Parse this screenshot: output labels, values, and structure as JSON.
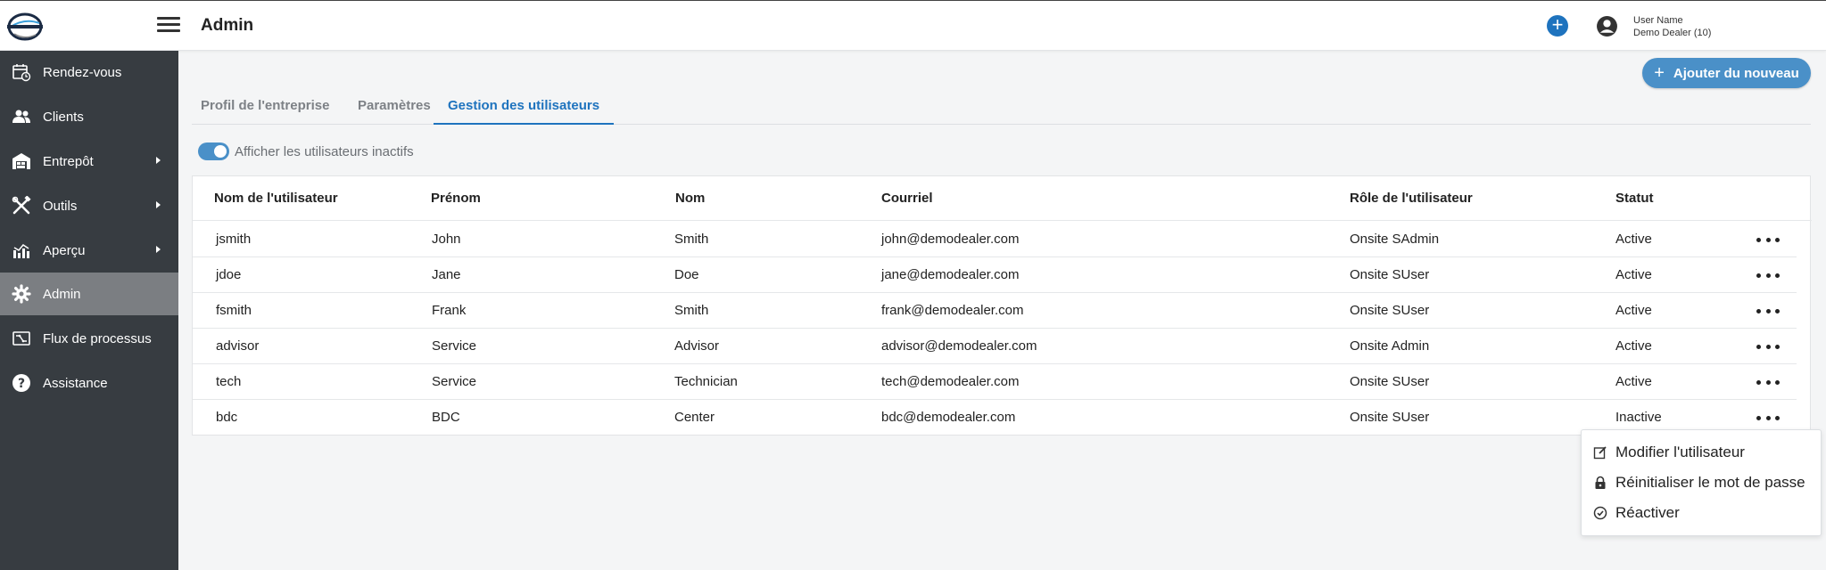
{
  "header": {
    "page_title": "Admin",
    "user_name": "User Name",
    "user_dealer": "Demo Dealer (10)"
  },
  "sidebar": {
    "items": [
      {
        "label": "Rendez-vous",
        "icon": "calendar-clock-icon"
      },
      {
        "label": "Clients",
        "icon": "users-icon"
      },
      {
        "label": "Entrepôt",
        "icon": "warehouse-icon",
        "expandable": true
      },
      {
        "label": "Outils",
        "icon": "tools-icon",
        "expandable": true
      },
      {
        "label": "Aperçu",
        "icon": "chart-icon",
        "expandable": true
      },
      {
        "label": "Admin",
        "icon": "gear-icon",
        "active": true
      },
      {
        "label": "Flux de processus",
        "icon": "workflow-icon"
      },
      {
        "label": "Assistance",
        "icon": "help-icon"
      }
    ]
  },
  "actions": {
    "add_new_label": "Ajouter du nouveau"
  },
  "tabs": [
    {
      "label": "Profil de l'entreprise",
      "active": false
    },
    {
      "label": "Paramètres",
      "active": false
    },
    {
      "label": "Gestion des utilisateurs",
      "active": true
    }
  ],
  "toggle": {
    "label": "Afficher les utilisateurs inactifs",
    "on": true
  },
  "table": {
    "headers": [
      "Nom de l'utilisateur",
      "Prénom",
      "Nom",
      "Courriel",
      "Rôle de l'utilisateur",
      "Statut"
    ],
    "rows": [
      [
        "jsmith",
        "John",
        "Smith",
        "john@demodealer.com",
        "Onsite SAdmin",
        "Active"
      ],
      [
        "jdoe",
        "Jane",
        "Doe",
        "jane@demodealer.com",
        "Onsite SUser",
        "Active"
      ],
      [
        "fsmith",
        "Frank",
        "Smith",
        "frank@demodealer.com",
        "Onsite SUser",
        "Active"
      ],
      [
        "advisor",
        "Service",
        "Advisor",
        "advisor@demodealer.com",
        "Onsite Admin",
        "Active"
      ],
      [
        "tech",
        "Service",
        "Technician",
        "tech@demodealer.com",
        "Onsite SUser",
        "Active"
      ],
      [
        "bdc",
        "BDC",
        "Center",
        "bdc@demodealer.com",
        "Onsite SUser",
        "Inactive"
      ]
    ]
  },
  "context_menu": {
    "items": [
      {
        "label": "Modifier l'utilisateur",
        "icon": "edit-icon"
      },
      {
        "label": "Réinitialiser le mot de passe",
        "icon": "lock-icon"
      },
      {
        "label": "Réactiver",
        "icon": "check-circle-icon"
      }
    ]
  },
  "colors": {
    "accent": "#1e73be",
    "button": "#4a90c8",
    "sidebar": "#373c41",
    "sidebar_active": "#7b7e82"
  }
}
